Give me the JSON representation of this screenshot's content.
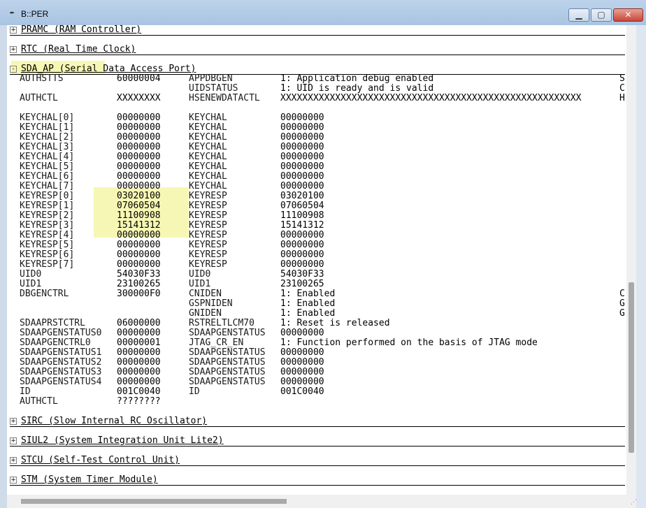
{
  "window": {
    "title": "B::PER",
    "min_icon": "minimize-icon",
    "max_icon": "maximize-icon",
    "close_icon": "close-icon"
  },
  "groups_top": [
    {
      "toggle": "+",
      "label": "PRAMC (RAM Controller)"
    },
    {
      "toggle": "+",
      "label": "RTC (Real Time Clock)"
    }
  ],
  "sda": {
    "toggle": "-",
    "label": "SDA_AP (Serial Data Access Port)",
    "rows": [
      {
        "n1": "AUTHSTTS",
        "v1": "60000004",
        "n2": "APPDBGEN",
        "v2": "1: Application debug enabled",
        "e": "S"
      },
      {
        "n1": "",
        "v1": "",
        "n2": "UIDSTATUS",
        "v2": "1: UID is ready and is valid",
        "e": "C"
      },
      {
        "n1": "AUTHCTL",
        "v1": "XXXXXXXX",
        "n2": "HSENEWDATACTL",
        "v2": "XXXXXXXXXXXXXXXXXXXXXXXXXXXXXXXXXXXXXXXXXXXXXXXXXXXXXXX",
        "e": "H"
      },
      {
        "n1": "",
        "v1": "",
        "n2": "",
        "v2": "",
        "e": ""
      },
      {
        "n1": "KEYCHAL[0]",
        "v1": "00000000",
        "n2": "KEYCHAL",
        "v2": "00000000",
        "e": ""
      },
      {
        "n1": "KEYCHAL[1]",
        "v1": "00000000",
        "n2": "KEYCHAL",
        "v2": "00000000",
        "e": ""
      },
      {
        "n1": "KEYCHAL[2]",
        "v1": "00000000",
        "n2": "KEYCHAL",
        "v2": "00000000",
        "e": ""
      },
      {
        "n1": "KEYCHAL[3]",
        "v1": "00000000",
        "n2": "KEYCHAL",
        "v2": "00000000",
        "e": ""
      },
      {
        "n1": "KEYCHAL[4]",
        "v1": "00000000",
        "n2": "KEYCHAL",
        "v2": "00000000",
        "e": ""
      },
      {
        "n1": "KEYCHAL[5]",
        "v1": "00000000",
        "n2": "KEYCHAL",
        "v2": "00000000",
        "e": ""
      },
      {
        "n1": "KEYCHAL[6]",
        "v1": "00000000",
        "n2": "KEYCHAL",
        "v2": "00000000",
        "e": ""
      },
      {
        "n1": "KEYCHAL[7]",
        "v1": "00000000",
        "n2": "KEYCHAL",
        "v2": "00000000",
        "e": ""
      },
      {
        "n1": "KEYRESP[0]",
        "v1": "03020100",
        "n2": "KEYRESP",
        "v2": "03020100",
        "e": ""
      },
      {
        "n1": "KEYRESP[1]",
        "v1": "07060504",
        "n2": "KEYRESP",
        "v2": "07060504",
        "e": ""
      },
      {
        "n1": "KEYRESP[2]",
        "v1": "11100908",
        "n2": "KEYRESP",
        "v2": "11100908",
        "e": ""
      },
      {
        "n1": "KEYRESP[3]",
        "v1": "15141312",
        "n2": "KEYRESP",
        "v2": "15141312",
        "e": ""
      },
      {
        "n1": "KEYRESP[4]",
        "v1": "00000000",
        "n2": "KEYRESP",
        "v2": "00000000",
        "e": ""
      },
      {
        "n1": "KEYRESP[5]",
        "v1": "00000000",
        "n2": "KEYRESP",
        "v2": "00000000",
        "e": ""
      },
      {
        "n1": "KEYRESP[6]",
        "v1": "00000000",
        "n2": "KEYRESP",
        "v2": "00000000",
        "e": ""
      },
      {
        "n1": "KEYRESP[7]",
        "v1": "00000000",
        "n2": "KEYRESP",
        "v2": "00000000",
        "e": ""
      },
      {
        "n1": "UID0",
        "v1": "54030F33",
        "n2": "UID0",
        "v2": "54030F33",
        "e": ""
      },
      {
        "n1": "UID1",
        "v1": "23100265",
        "n2": "UID1",
        "v2": "23100265",
        "e": ""
      },
      {
        "n1": "DBGENCTRL",
        "v1": "300000F0",
        "n2": "CNIDEN",
        "v2": "1: Enabled",
        "e": "C"
      },
      {
        "n1": "",
        "v1": "",
        "n2": "GSPNIDEN",
        "v2": "1: Enabled",
        "e": "G"
      },
      {
        "n1": "",
        "v1": "",
        "n2": "GNIDEN",
        "v2": "1: Enabled",
        "e": "G"
      },
      {
        "n1": "SDAAPRSTCTRL",
        "v1": "06000000",
        "n2": "RSTRELTLCM70",
        "v2": "1: Reset is released",
        "e": ""
      },
      {
        "n1": "SDAAPGENSTATUS0",
        "v1": "00000000",
        "n2": "SDAAPGENSTATUS",
        "v2": "00000000",
        "e": ""
      },
      {
        "n1": "SDAAPGENCTRL0",
        "v1": "00000001",
        "n2": "JTAG_CR_EN",
        "v2": "1: Function performed on the basis of JTAG mode",
        "e": ""
      },
      {
        "n1": "SDAAPGENSTATUS1",
        "v1": "00000000",
        "n2": "SDAAPGENSTATUS",
        "v2": "00000000",
        "e": ""
      },
      {
        "n1": "SDAAPGENSTATUS2",
        "v1": "00000000",
        "n2": "SDAAPGENSTATUS",
        "v2": "00000000",
        "e": ""
      },
      {
        "n1": "SDAAPGENSTATUS3",
        "v1": "00000000",
        "n2": "SDAAPGENSTATUS",
        "v2": "00000000",
        "e": ""
      },
      {
        "n1": "SDAAPGENSTATUS4",
        "v1": "00000000",
        "n2": "SDAAPGENSTATUS",
        "v2": "00000000",
        "e": ""
      },
      {
        "n1": "ID",
        "v1": "001C0040",
        "n2": "ID",
        "v2": "001C0040",
        "e": ""
      },
      {
        "n1": "AUTHCTL",
        "v1": "????????",
        "n2": "",
        "v2": "",
        "e": ""
      }
    ]
  },
  "groups_bottom": [
    {
      "toggle": "+",
      "label": "SIRC (Slow Internal RC Oscillator)"
    },
    {
      "toggle": "+",
      "label": "SIUL2 (System Integration Unit Lite2)"
    },
    {
      "toggle": "+",
      "label": "STCU (Self-Test Control Unit)"
    },
    {
      "toggle": "+",
      "label": "STM (System Timer Module)"
    }
  ],
  "colors": {
    "highlight": "#f6f7b4",
    "titlebar": "#bcd3ea",
    "close": "#c8463a"
  }
}
